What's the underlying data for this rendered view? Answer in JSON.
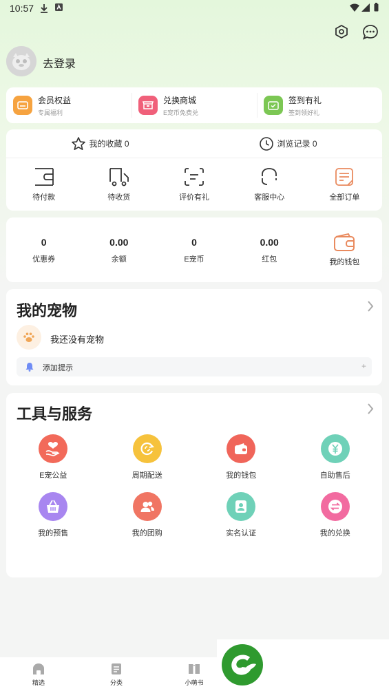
{
  "status_bar": {
    "time": "10:57"
  },
  "profile": {
    "login_label": "去登录"
  },
  "promo": [
    {
      "title": "会员权益",
      "subtitle": "专属福利",
      "color": "#f6a340"
    },
    {
      "title": "兑换商城",
      "subtitle": "E宠币免费兑",
      "color": "#f0607a"
    },
    {
      "title": "签到有礼",
      "subtitle": "签到领好礼",
      "color": "#7cc754"
    }
  ],
  "orders": {
    "favorites_label": "我的收藏 0",
    "history_label": "浏览记录 0",
    "items": [
      {
        "label": "待付款",
        "icon": "wallet-icon"
      },
      {
        "label": "待收货",
        "icon": "truck-icon"
      },
      {
        "label": "评价有礼",
        "icon": "comment-icon"
      },
      {
        "label": "客服中心",
        "icon": "headset-icon"
      },
      {
        "label": "全部订单",
        "icon": "order-list-icon"
      }
    ]
  },
  "wallet": [
    {
      "value": "0",
      "label": "优惠券"
    },
    {
      "value": "0.00",
      "label": "余额"
    },
    {
      "value": "0",
      "label": "E宠币"
    },
    {
      "value": "0.00",
      "label": "红包"
    },
    {
      "value": "",
      "label": "我的钱包"
    }
  ],
  "pets": {
    "title": "我的宠物",
    "empty_text": "我还没有宠物",
    "reminder_label": "添加提示",
    "reminder_plus": "+"
  },
  "tools": {
    "title": "工具与服务",
    "items": [
      {
        "label": "E宠公益",
        "icon": "charity-icon",
        "color": "#f26a5a"
      },
      {
        "label": "周期配送",
        "icon": "cycle-delivery-icon",
        "color": "#f6c23c"
      },
      {
        "label": "我的钱包",
        "icon": "wallet-icon",
        "color": "#f0655a"
      },
      {
        "label": "自助售后",
        "icon": "yen-icon",
        "color": "#6fd1b8"
      },
      {
        "label": "我的预售",
        "icon": "basket-icon",
        "color": "#a886f0"
      },
      {
        "label": "我的团购",
        "icon": "group-icon",
        "color": "#f07563"
      },
      {
        "label": "实名认证",
        "icon": "id-card-icon",
        "color": "#6fd1b8"
      },
      {
        "label": "我的兑换",
        "icon": "exchange-icon",
        "color": "#f26ba0"
      }
    ]
  },
  "bottom_nav": [
    {
      "label": "精选",
      "icon": "home-icon"
    },
    {
      "label": "分类",
      "icon": "category-icon"
    },
    {
      "label": "小萌书",
      "icon": "book-icon"
    }
  ]
}
